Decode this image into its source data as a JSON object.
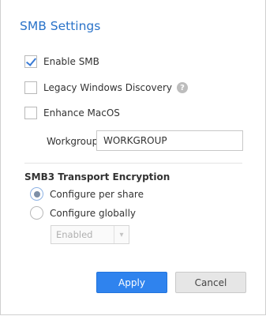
{
  "dialog": {
    "title": "SMB Settings"
  },
  "options": {
    "enable_smb": {
      "label": "Enable SMB",
      "checked": true
    },
    "legacy_discovery": {
      "label": "Legacy Windows Discovery",
      "checked": false,
      "help_icon": "question-icon"
    },
    "enhance_macos": {
      "label": "Enhance MacOS",
      "checked": false
    }
  },
  "workgroup": {
    "label": "Workgroup:",
    "value": "WORKGROUP"
  },
  "encryption": {
    "title": "SMB3 Transport Encryption",
    "per_share": {
      "label": "Configure per share",
      "selected": true
    },
    "globally": {
      "label": "Configure globally",
      "selected": false
    },
    "global_select_value": "Enabled"
  },
  "buttons": {
    "apply": "Apply",
    "cancel": "Cancel"
  },
  "colors": {
    "title": "#2a73c9",
    "primary_button": "#2f83ee",
    "checkmark": "#3a7bd5"
  }
}
